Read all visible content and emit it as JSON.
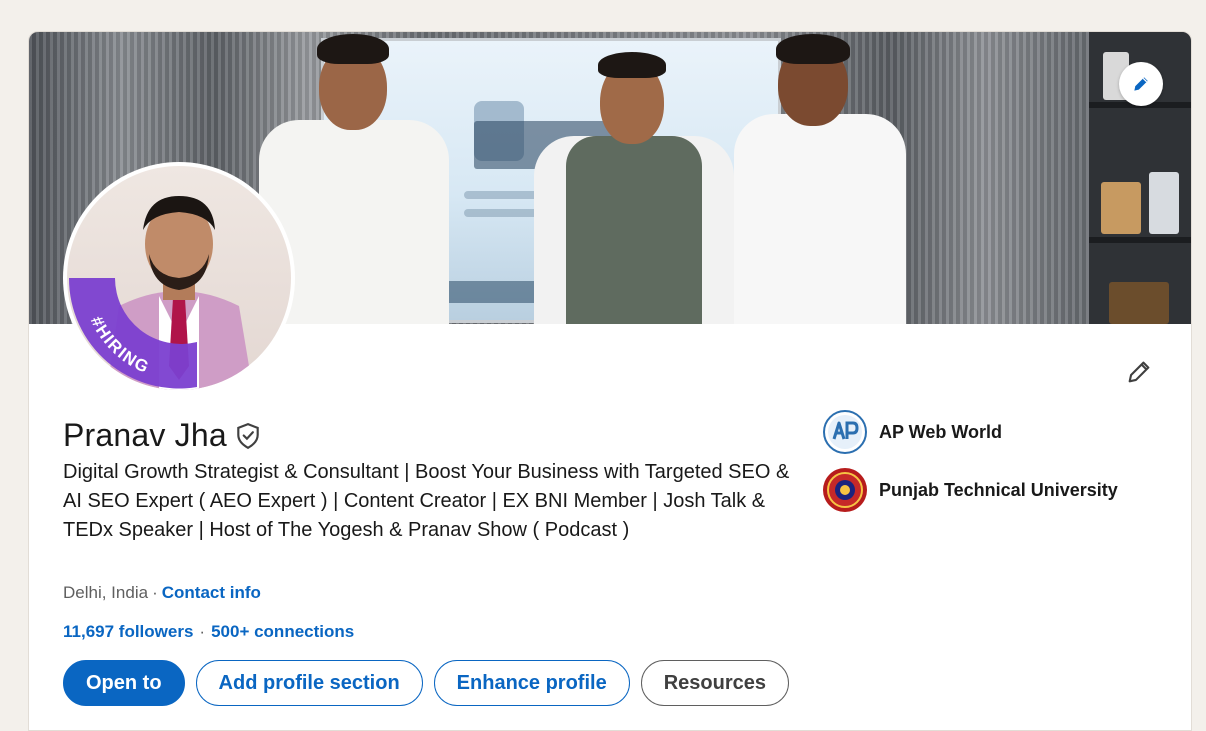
{
  "profile": {
    "name": "Pranav Jha",
    "headline": "Digital Growth Strategist & Consultant | Boost Your Business with Targeted SEO & AI SEO Expert ( AEO Expert ) | Content Creator | EX BNI Member | Josh Talk & TEDx Speaker | Host of The Yogesh & Pranav Show ( Podcast )",
    "location": "Delhi, India",
    "contact_label": "Contact info",
    "followers": "11,697 followers",
    "connections": "500+ connections",
    "hiring_frame_text": "#HIRING"
  },
  "organizations": [
    {
      "name": "AP Web World",
      "logo_icon": "ap-web-world-logo"
    },
    {
      "name": "Punjab Technical University",
      "logo_icon": "ptu-seal-logo"
    }
  ],
  "actions": {
    "open_to": "Open to",
    "add_section": "Add profile section",
    "enhance": "Enhance profile",
    "resources": "Resources"
  },
  "colors": {
    "primary": "#0a66c2",
    "hiring_purple": "#7b3fd0",
    "page_bg": "#f3f0eb"
  }
}
